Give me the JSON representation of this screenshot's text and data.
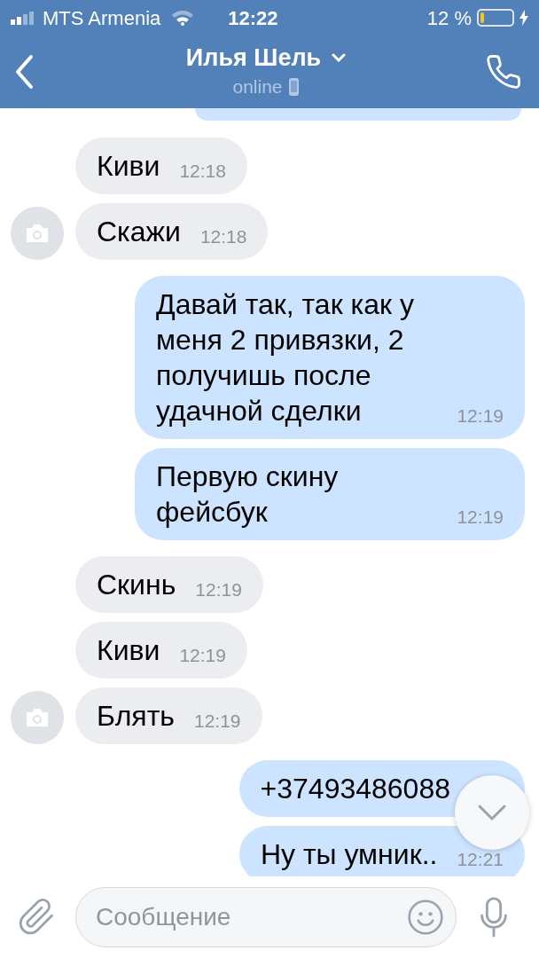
{
  "status_bar": {
    "carrier": "MTS Armenia",
    "time": "12:22",
    "battery": "12 %"
  },
  "header": {
    "name": "Илья Шель",
    "status": "online"
  },
  "messages": [
    {
      "kind": "in",
      "avatar": false,
      "text": "Киви",
      "time": "12:18"
    },
    {
      "kind": "in",
      "avatar": true,
      "text": "Скажи",
      "time": "12:18"
    },
    {
      "kind": "out",
      "text": "Давай так, так как у меня 2 привязки, 2 получишь после удачной сделки",
      "time": "12:19"
    },
    {
      "kind": "out",
      "text": "Первую скину фейсбук",
      "time": "12:19"
    },
    {
      "kind": "in",
      "avatar": false,
      "text": "Скинь",
      "time": "12:19"
    },
    {
      "kind": "in",
      "avatar": false,
      "text": "Киви",
      "time": "12:19"
    },
    {
      "kind": "in",
      "avatar": true,
      "text": "Блять",
      "time": "12:19"
    },
    {
      "kind": "out",
      "text": "+37493486088"
    },
    {
      "kind": "out",
      "text": "Ну ты умник..",
      "time": "12:21"
    }
  ],
  "composer": {
    "placeholder": "Сообщение"
  }
}
